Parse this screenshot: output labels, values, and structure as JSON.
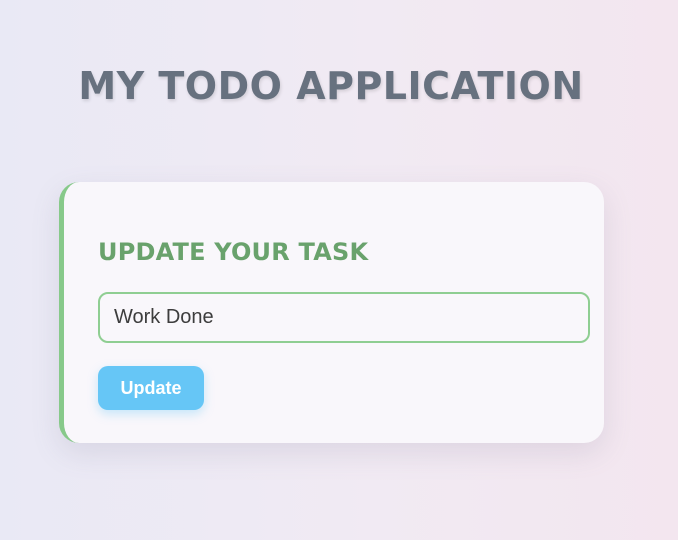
{
  "header": {
    "title": "MY TODO APPLICATION"
  },
  "update_card": {
    "heading": "UPDATE YOUR TASK",
    "task_input": {
      "value": "Work Done",
      "placeholder": ""
    },
    "update_button_label": "Update"
  },
  "colors": {
    "title_text": "#67717f",
    "heading_text": "#69a26c",
    "accent_green": "#87c98a",
    "button_blue": "#66c6f6",
    "card_background": "#f9f7fb"
  }
}
